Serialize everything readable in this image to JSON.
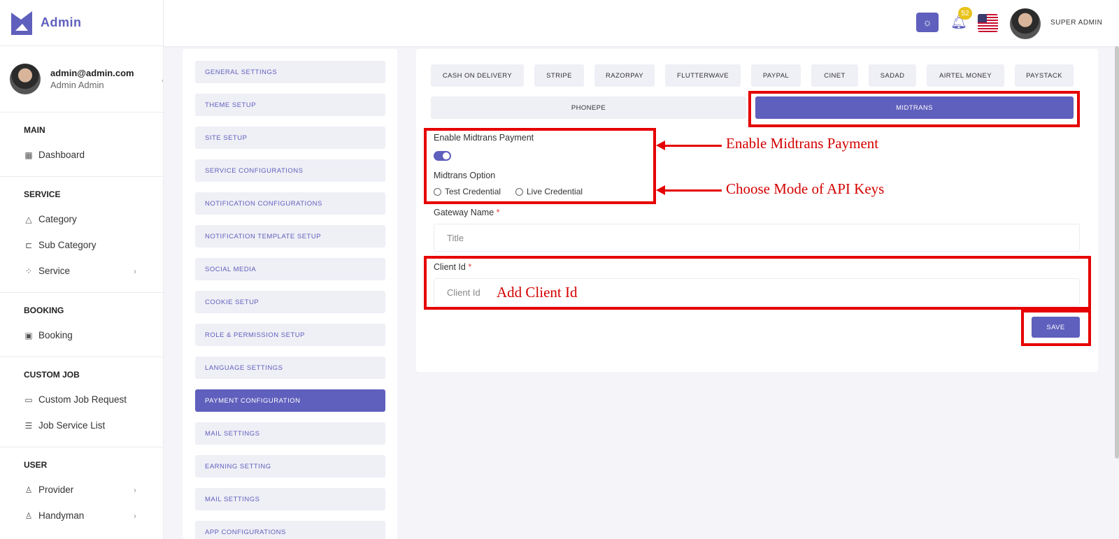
{
  "brand": {
    "name": "Admin",
    "logo_icon": "logo-icon"
  },
  "profile": {
    "email": "admin@admin.com",
    "name": "Admin Admin"
  },
  "sidebar": {
    "groups": [
      {
        "title": "MAIN",
        "items": [
          {
            "label": "Dashboard",
            "icon": "grid-icon"
          }
        ]
      },
      {
        "title": "SERVICE",
        "items": [
          {
            "label": "Category",
            "icon": "shapes-icon"
          },
          {
            "label": "Sub Category",
            "icon": "sitemap-icon"
          },
          {
            "label": "Service",
            "icon": "apps-icon",
            "has_children": true
          }
        ]
      },
      {
        "title": "BOOKING",
        "items": [
          {
            "label": "Booking",
            "icon": "calendar-icon"
          }
        ]
      },
      {
        "title": "CUSTOM JOB",
        "items": [
          {
            "label": "Custom Job Request",
            "icon": "briefcase-icon"
          },
          {
            "label": "Job Service List",
            "icon": "list-icon"
          }
        ]
      },
      {
        "title": "USER",
        "items": [
          {
            "label": "Provider",
            "icon": "user-icon",
            "has_children": true
          },
          {
            "label": "Handyman",
            "icon": "user-icon",
            "has_children": true
          }
        ]
      }
    ]
  },
  "header": {
    "notification_count": "52",
    "user_role": "SUPER ADMIN"
  },
  "settings_menu": [
    "GENERAL SETTINGS",
    "THEME SETUP",
    "SITE SETUP",
    "SERVICE CONFIGURATIONS",
    "NOTIFICATION CONFIGURATIONS",
    "NOTIFICATION TEMPLATE SETUP",
    "SOCIAL MEDIA",
    "COOKIE SETUP",
    "ROLE & PERMISSION SETUP",
    "LANGUAGE SETTINGS",
    "PAYMENT CONFIGURATION",
    "MAIL SETTINGS",
    "EARNING SETTING",
    "MAIL SETTINGS",
    "APP CONFIGURATIONS"
  ],
  "settings_active": "PAYMENT CONFIGURATION",
  "payment_tabs": [
    "CASH ON DELIVERY",
    "STRIPE",
    "RAZORPAY",
    "FLUTTERWAVE",
    "PAYPAL",
    "CINET",
    "SADAD",
    "AIRTEL MONEY",
    "PAYSTACK",
    "PHONEPE",
    "MIDTRANS"
  ],
  "payment_tab_active": "MIDTRANS",
  "form": {
    "enable_label": "Enable Midtrans Payment",
    "enabled": true,
    "option_label": "Midtrans Option",
    "option_test": "Test Credential",
    "option_live": "Live Credential",
    "gateway_label": "Gateway Name",
    "gateway_placeholder": "Title",
    "client_label": "Client Id",
    "client_placeholder": "Client Id",
    "required_mark": "*",
    "save_label": "SAVE"
  },
  "annotations": {
    "enable": "Enable Midtrans Payment",
    "mode": "Choose Mode of API Keys",
    "client": "Add Client Id"
  },
  "colors": {
    "accent": "#5f5fbd",
    "annotation": "#e60000",
    "badge": "#e8c31c"
  }
}
